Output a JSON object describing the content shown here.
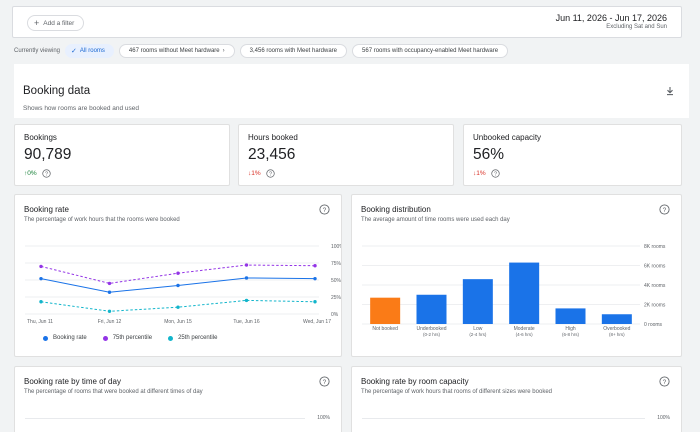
{
  "filter": {
    "add_label": "Add a filter"
  },
  "date_range": {
    "dates": "Jun 11, 2026 - Jun 17, 2026",
    "excluding": "Excluding Sat and Sun"
  },
  "viewing": {
    "label": "Currently viewing",
    "chips": [
      "All rooms",
      "467 rooms without Meet hardware",
      "3,456 rooms with Meet hardware",
      "567 rooms with occupancy-enabled Meet hardware"
    ]
  },
  "section": {
    "title": "Booking data",
    "subtitle": "Shows how rooms are booked and used"
  },
  "kpis": [
    {
      "label": "Bookings",
      "value": "90,789",
      "delta": "0%",
      "arrow": "↑",
      "direction": "up"
    },
    {
      "label": "Hours booked",
      "value": "23,456",
      "delta": "1%",
      "arrow": "↓",
      "direction": "down"
    },
    {
      "label": "Unbooked capacity",
      "value": "56%",
      "delta": "1%",
      "arrow": "↓",
      "direction": "down"
    }
  ],
  "cards": {
    "booking_rate": {
      "title": "Booking rate",
      "subtitle": "The percentage of work hours that the rooms were booked"
    },
    "booking_distribution": {
      "title": "Booking distribution",
      "subtitle": "The average amount of time rooms were used each day"
    },
    "rate_by_time": {
      "title": "Booking rate by time of day",
      "subtitle": "The percentage of rooms that were booked at different times of day",
      "axis_top": "100%"
    },
    "rate_by_capacity": {
      "title": "Booking rate by room capacity",
      "subtitle": "The percentage of work hours that rooms of different sizes were booked",
      "axis_top": "100%"
    }
  },
  "colors": {
    "blue": "#1a73e8",
    "purple": "#9334e6",
    "teal": "#12b5cb",
    "orange": "#fa7b17",
    "grid": "#e8eaed"
  },
  "chart_data": [
    {
      "type": "line",
      "categories": [
        "Thu, Jun 11",
        "Fri, Jun 12",
        "Mon, Jun 15",
        "Tue, Jun 16",
        "Wed, Jun 17"
      ],
      "yticks": [
        "100%",
        "75%",
        "50%",
        "25%",
        "0%"
      ],
      "ylim": [
        0,
        100
      ],
      "series": [
        {
          "name": "Booking rate",
          "values": [
            52,
            32,
            42,
            53,
            52
          ],
          "color": "#1a73e8",
          "style": "solid"
        },
        {
          "name": "75th percentile",
          "values": [
            70,
            45,
            60,
            72,
            71
          ],
          "color": "#9334e6",
          "style": "dashed"
        },
        {
          "name": "25th percentile",
          "values": [
            18,
            4,
            10,
            20,
            18
          ],
          "color": "#12b5cb",
          "style": "dashed"
        }
      ]
    },
    {
      "type": "bar",
      "categories": [
        "Not booked",
        "Underbooked",
        "Low",
        "Moderate",
        "High",
        "Overbooked"
      ],
      "sublabels": [
        "",
        "(0-2 hrs)",
        "(2-4 hrs)",
        "(4-6 hrs)",
        "(6-8 hrs)",
        "(8+ hrs)"
      ],
      "values": [
        2700,
        3000,
        4600,
        6300,
        1600,
        1000
      ],
      "colors": [
        "#fa7b17",
        "#1a73e8",
        "#1a73e8",
        "#1a73e8",
        "#1a73e8",
        "#1a73e8"
      ],
      "yticks": [
        "8K rooms",
        "6K rooms",
        "4K rooms",
        "2K rooms",
        "0 rooms"
      ],
      "ylim": [
        0,
        8000
      ]
    }
  ]
}
